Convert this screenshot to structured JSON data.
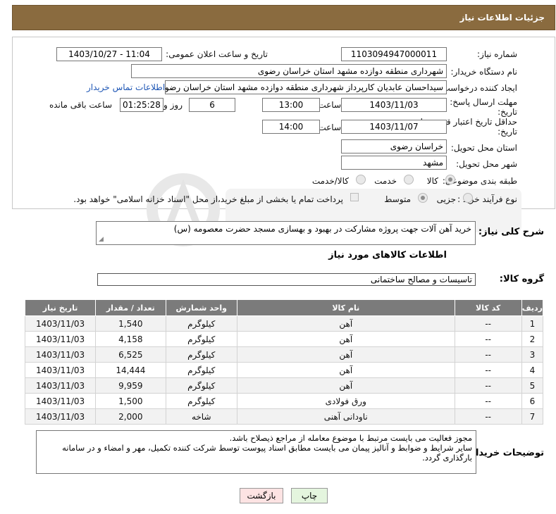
{
  "header": {
    "title": "جزئیات اطلاعات نیاز"
  },
  "fields": {
    "need_number_label": "شماره نیاز:",
    "need_number": "1103094947000011",
    "announce_label": "تاریخ و ساعت اعلان عمومی:",
    "announce_value": "1403/10/27 - 11:04",
    "buyer_label": "نام دستگاه خریدار:",
    "buyer_value": "شهرداری منطقه دوازده مشهد استان خراسان رضوی",
    "creator_label": "ایجاد کننده درخواست:",
    "creator_value": "سیداحسان عابدیان کارپرداز شهرداری منطقه دوازده مشهد استان خراسان رضوی",
    "contact_link": "اطلاعات تماس خریدار",
    "deadline_label_1": "مهلت ارسال پاسخ: تا",
    "deadline_label_2": "تاریخ:",
    "deadline_date": "1403/11/03",
    "time_label": "ساعت",
    "deadline_time": "13:00",
    "days_value": "6",
    "days_label": "روز و",
    "remaining_value": "01:25:28",
    "remaining_label": "ساعت باقی مانده",
    "validity_label_1": "حداقل تاریخ اعتبار قیمت: تا",
    "validity_label_2": "تاریخ:",
    "validity_date": "1403/11/07",
    "validity_time": "14:00",
    "province_label": "استان محل تحویل:",
    "province_value": "خراسان رضوی",
    "city_label": "شهر محل تحویل:",
    "city_value": "مشهد",
    "category_label": "طبقه بندی موضوعی:",
    "category_options": [
      "کالا",
      "خدمت",
      "کالا/خدمت"
    ],
    "purchase_label": "نوع فرآیند خرید :",
    "purchase_options": [
      "جزیی",
      "متوسط"
    ],
    "payment_note": "پرداخت تمام یا بخشی از مبلغ خرید،از محل \"اسناد خزانه اسلامی\" خواهد بود."
  },
  "description": {
    "label": "شرح کلی نیاز:",
    "value": "خرید آهن آلات جهت پروژه مشارکت در بهبود و بهسازی مسجد حضرت معصومه (س)"
  },
  "goods": {
    "title": "اطلاعات کالاهای مورد نیاز",
    "group_label": "گروه کالا:",
    "group_value": "تاسیسات و مصالح ساختمانی",
    "columns": [
      "ردیف",
      "کد کالا",
      "نام کالا",
      "واحد شمارش",
      "تعداد / مقدار",
      "تاریخ نیاز"
    ],
    "rows": [
      [
        "1",
        "--",
        "آهن",
        "کیلوگرم",
        "1,540",
        "1403/11/03"
      ],
      [
        "2",
        "--",
        "آهن",
        "کیلوگرم",
        "4,158",
        "1403/11/03"
      ],
      [
        "3",
        "--",
        "آهن",
        "کیلوگرم",
        "6,525",
        "1403/11/03"
      ],
      [
        "4",
        "--",
        "آهن",
        "کیلوگرم",
        "14,444",
        "1403/11/03"
      ],
      [
        "5",
        "--",
        "آهن",
        "کیلوگرم",
        "9,959",
        "1403/11/03"
      ],
      [
        "6",
        "--",
        "ورق فولادی",
        "کیلوگرم",
        "1,500",
        "1403/11/03"
      ],
      [
        "7",
        "--",
        "ناودانی آهنی",
        "شاخه",
        "2,000",
        "1403/11/03"
      ]
    ]
  },
  "buyer_notes": {
    "label": "توضیحات خریدار:",
    "lines": [
      "مجوز فعالیت می بایست مرتبط با موضوع معامله از مراجع ذیصلاح باشد.",
      "سایر شرایط و ضوابط و آنالیز پیمان می بایست مطابق اسناد پیوست توسط شرکت کننده تکمیل، مهر و امضاء و در سامانه",
      "بارگذاری گردد."
    ]
  },
  "buttons": {
    "back": "بازگشت",
    "print": "چاپ"
  },
  "colors": {
    "header_bg": "#8a6b3f",
    "table_header_bg": "#7b7b7b",
    "link": "#1f57b5",
    "back_btn_bg": "#fde3e3",
    "print_btn_bg": "#e4f5de"
  }
}
